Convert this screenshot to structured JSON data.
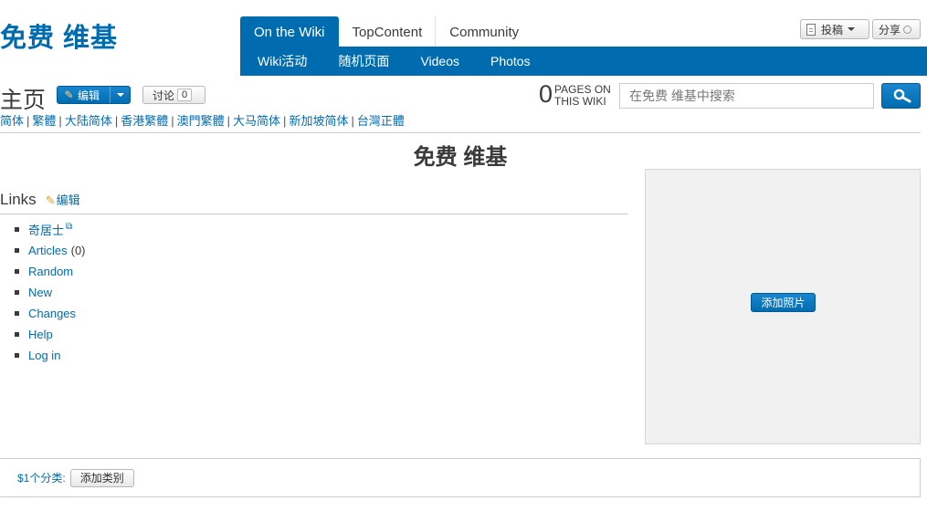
{
  "header": {
    "wordmark": "免费 维基",
    "nav_tabs": [
      {
        "label": "On the Wiki",
        "active": true
      },
      {
        "label": "TopContent",
        "active": false
      },
      {
        "label": "Community",
        "active": false
      }
    ],
    "nav_sub": [
      "Wiki活动",
      "随机页面",
      "Videos",
      "Photos"
    ],
    "contribute_label": "投稿",
    "share_label": "分享"
  },
  "page": {
    "title": "主页",
    "edit_label": "编辑",
    "talk_label": "讨论",
    "talk_count": "0",
    "pages_count": "0",
    "pages_label_1": "PAGES ON",
    "pages_label_2": "THIS WIKI",
    "search_placeholder": "在免费 维基中搜索",
    "language_variants": [
      "简体",
      "繁體",
      "大陆简体",
      "香港繁體",
      "澳門繁體",
      "大马简体",
      "新加坡简体",
      "台灣正體"
    ]
  },
  "article": {
    "title": "免费 维基",
    "section_title": "Links",
    "section_edit_label": "编辑",
    "links": [
      {
        "label": "奇居士",
        "external": true,
        "count": ""
      },
      {
        "label": "Articles",
        "external": false,
        "count": "(0)"
      },
      {
        "label": "Random",
        "external": false,
        "count": ""
      },
      {
        "label": "New",
        "external": false,
        "count": ""
      },
      {
        "label": "Changes",
        "external": false,
        "count": ""
      },
      {
        "label": "Help",
        "external": false,
        "count": ""
      },
      {
        "label": "Log in",
        "external": false,
        "count": ""
      }
    ],
    "add_photo_label": "添加照片"
  },
  "categories": {
    "count_label": "$1个分类:",
    "add_label": "添加类别"
  },
  "colors": {
    "brand_blue": "#006cb0",
    "text": "#3a3a3a",
    "photo_box_bg": "#f1f1f1"
  },
  "icons": [
    "document-icon",
    "chevron-down-icon",
    "share-ring-icon",
    "pencil-icon",
    "search-icon",
    "external-link-icon"
  ]
}
